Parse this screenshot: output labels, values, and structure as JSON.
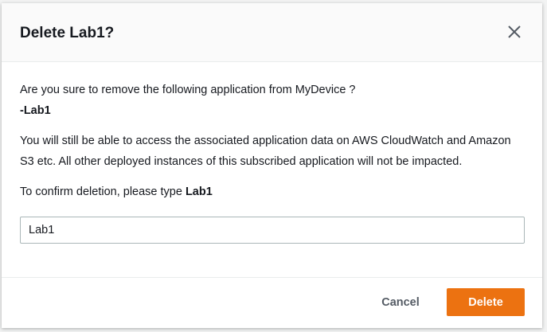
{
  "dialog": {
    "title": "Delete Lab1?",
    "question": "Are you sure to remove the following application from MyDevice ?",
    "item": "-Lab1",
    "note": "You will still be able to access the associated application data on AWS CloudWatch and Amazon S3 etc. All other deployed instances of this subscribed application will not be impacted.",
    "confirm_prefix": "To confirm deletion, please type ",
    "confirm_name": "Lab1",
    "input_value": "Lab1",
    "cancel_label": "Cancel",
    "delete_label": "Delete"
  },
  "colors": {
    "primary": "#ec7211"
  }
}
